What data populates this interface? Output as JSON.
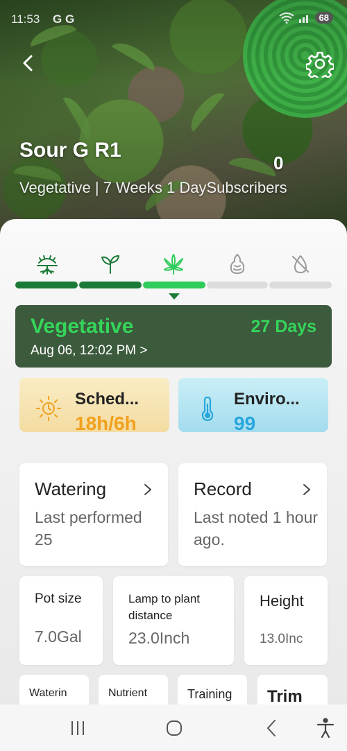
{
  "status_bar": {
    "time": "11:53",
    "carrier": "G G",
    "battery": "68"
  },
  "header": {
    "plant_name": "Sour G R1",
    "subtitle_stage": "Vegetative | 7 Weeks 1 Day",
    "subscribers_count": "0",
    "subscribers_label": "Subscribers",
    "back_icon": "chevron-left-icon",
    "settings_icon": "gear-icon"
  },
  "stages": {
    "icons": [
      "germination-icon",
      "seedling-icon",
      "cannabis-leaf-icon",
      "flower-bud-icon",
      "drying-icon"
    ],
    "current_index": 2,
    "colors": {
      "done": "#1b7a37",
      "current": "#2ecc5a",
      "pending": "#dcdcdc"
    }
  },
  "current_stage": {
    "name": "Vegetative",
    "days": "27 Days",
    "date": "Aug 06, 12:02 PM >"
  },
  "schedule": {
    "label": "Sched...",
    "value": "18h/6h",
    "icon": "sun-icon"
  },
  "environment": {
    "label": "Enviro...",
    "value": "99",
    "icon": "thermometer-icon"
  },
  "watering": {
    "title": "Watering",
    "description": "Last performed 25"
  },
  "record": {
    "title": "Record",
    "description": "Last noted 1 hour ago."
  },
  "stats": {
    "pot_size": {
      "label": "Pot size",
      "value": "7.0Gal"
    },
    "lamp_distance": {
      "label": "Lamp to plant distance",
      "value": "23.0Inch"
    },
    "height": {
      "label": "Height",
      "value": "13.0Inc"
    }
  },
  "tiles": [
    "Waterin",
    "Nutrient",
    "Training",
    "Trim"
  ],
  "nav": {
    "recents_icon": "recents-icon",
    "home_icon": "home-icon",
    "back_icon": "back-icon",
    "accessibility_icon": "accessibility-icon"
  }
}
